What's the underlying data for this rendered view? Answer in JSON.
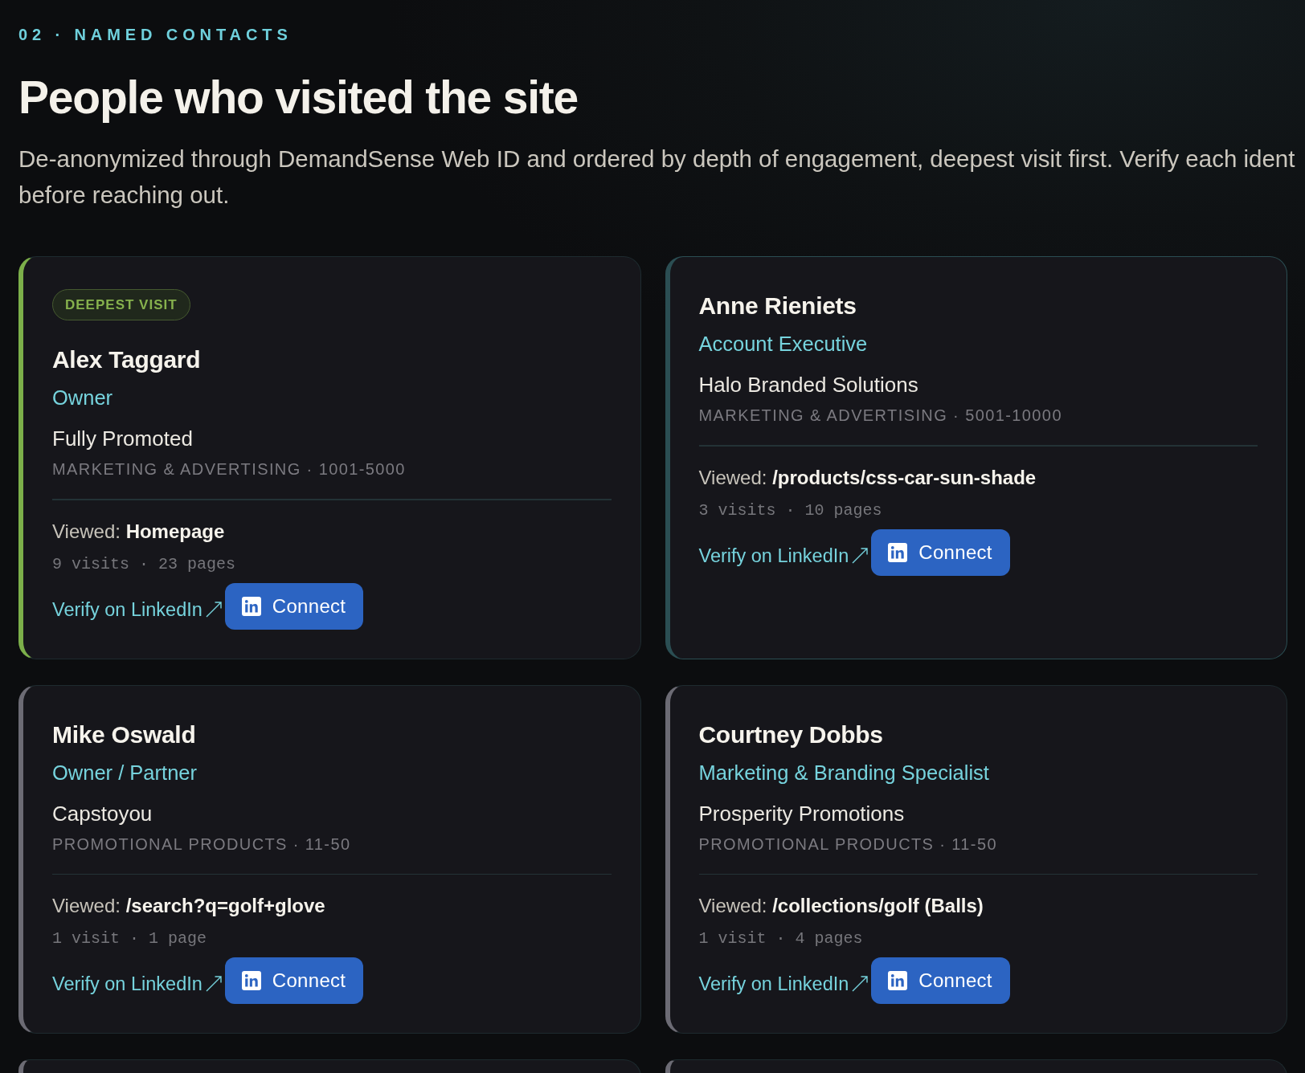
{
  "section": {
    "eyebrow": "02 · NAMED CONTACTS",
    "title": "People who visited the site",
    "description": [
      "De-anonymized through DemandSense Web ID and ordered by depth of engagement, deepest visit first. Verify each ident",
      "before reaching out."
    ]
  },
  "contacts": [
    {
      "badge": "DEEPEST VISIT",
      "name": "Alex Taggard",
      "role": "Owner",
      "company": "Fully Promoted",
      "meta": "MARKETING & ADVERTISING · 1001-5000",
      "viewed_label": "Viewed:",
      "viewed": "Homepage",
      "stats": "9 visits · 23 pages",
      "verify_link": "Verify on LinkedIn",
      "connect_button": "Connect",
      "color": "#7caf4a",
      "hovered": false
    },
    {
      "name": "Anne Rieniets",
      "role": "Account Executive",
      "company": "Halo Branded Solutions",
      "meta": "MARKETING & ADVERTISING · 5001-10000",
      "viewed_label": "Viewed:",
      "viewed": "/products/css-car-sun-shade",
      "stats": "3 visits · 10 pages",
      "verify_link": "Verify on LinkedIn",
      "connect_button": "Connect",
      "color": "#2b4e53",
      "hovered": true
    },
    {
      "name": "Mike Oswald",
      "role": "Owner / Partner",
      "company": "Capstoyou",
      "meta": "PROMOTIONAL PRODUCTS · 11-50",
      "viewed_label": "Viewed:",
      "viewed": "/search?q=golf+glove",
      "stats": "1 visit · 1 page",
      "verify_link": "Verify on LinkedIn",
      "connect_button": "Connect",
      "color": "#6c6b74",
      "hovered": false
    },
    {
      "name": "Courtney Dobbs",
      "role": "Marketing & Branding Specialist",
      "company": "Prosperity Promotions",
      "meta": "PROMOTIONAL PRODUCTS · 11-50",
      "viewed_label": "Viewed:",
      "viewed": "/collections/golf (Balls)",
      "stats": "1 visit · 4 pages",
      "verify_link": "Verify on LinkedIn",
      "connect_button": "Connect",
      "color": "#6c6b74",
      "hovered": false
    },
    {
      "hovered": false
    },
    {
      "hovered": false
    }
  ]
}
